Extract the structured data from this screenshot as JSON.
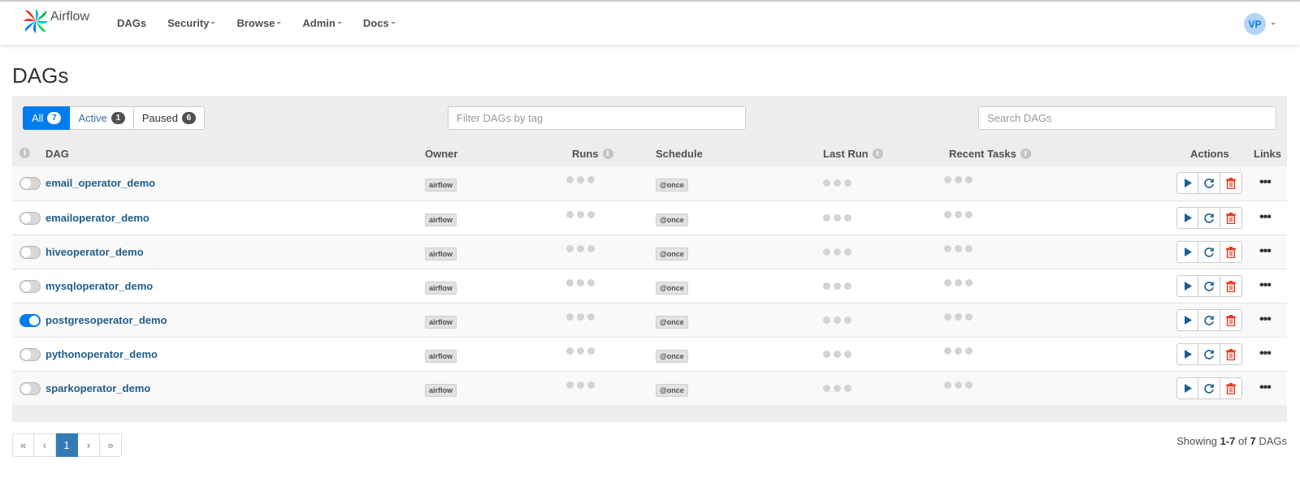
{
  "brand": {
    "name": "Airflow"
  },
  "nav": [
    {
      "label": "DAGs",
      "dropdown": false
    },
    {
      "label": "Security",
      "dropdown": true
    },
    {
      "label": "Browse",
      "dropdown": true
    },
    {
      "label": "Admin",
      "dropdown": true
    },
    {
      "label": "Docs",
      "dropdown": true
    }
  ],
  "user": {
    "initials": "VP"
  },
  "page": {
    "title": "DAGs"
  },
  "filters": {
    "all": {
      "label": "All",
      "count": "7"
    },
    "active": {
      "label": "Active",
      "count": "1"
    },
    "paused": {
      "label": "Paused",
      "count": "6"
    }
  },
  "tag_filter": {
    "placeholder": "Filter DAGs by tag"
  },
  "search": {
    "placeholder": "Search DAGs"
  },
  "columns": {
    "dag": "DAG",
    "owner": "Owner",
    "runs": "Runs",
    "schedule": "Schedule",
    "last_run": "Last Run",
    "recent_tasks": "Recent Tasks",
    "actions": "Actions",
    "links": "Links"
  },
  "icons": {
    "info": "info-icon",
    "trigger": "play-icon",
    "refresh": "refresh-icon",
    "delete": "trash-icon",
    "links": "more-icon"
  },
  "dags": [
    {
      "id": "email_operator_demo",
      "owner": "airflow",
      "schedule": "@once",
      "active": false
    },
    {
      "id": "emailoperator_demo",
      "owner": "airflow",
      "schedule": "@once",
      "active": false
    },
    {
      "id": "hiveoperator_demo",
      "owner": "airflow",
      "schedule": "@once",
      "active": false
    },
    {
      "id": "mysqloperator_demo",
      "owner": "airflow",
      "schedule": "@once",
      "active": false
    },
    {
      "id": "postgresoperator_demo",
      "owner": "airflow",
      "schedule": "@once",
      "active": true
    },
    {
      "id": "pythonoperator_demo",
      "owner": "airflow",
      "schedule": "@once",
      "active": false
    },
    {
      "id": "sparkoperator_demo",
      "owner": "airflow",
      "schedule": "@once",
      "active": false
    }
  ],
  "pagination": {
    "first": "«",
    "prev": "‹",
    "current": "1",
    "next": "›",
    "last": "»"
  },
  "showing": {
    "prefix": "Showing",
    "range": "1-7",
    "of": "of",
    "total": "7",
    "suffix": "DAGs"
  },
  "colors": {
    "accent": "#017cee",
    "dag_link": "#1f5d8e",
    "delete": "#e43921",
    "page_active": "#337ab7"
  }
}
